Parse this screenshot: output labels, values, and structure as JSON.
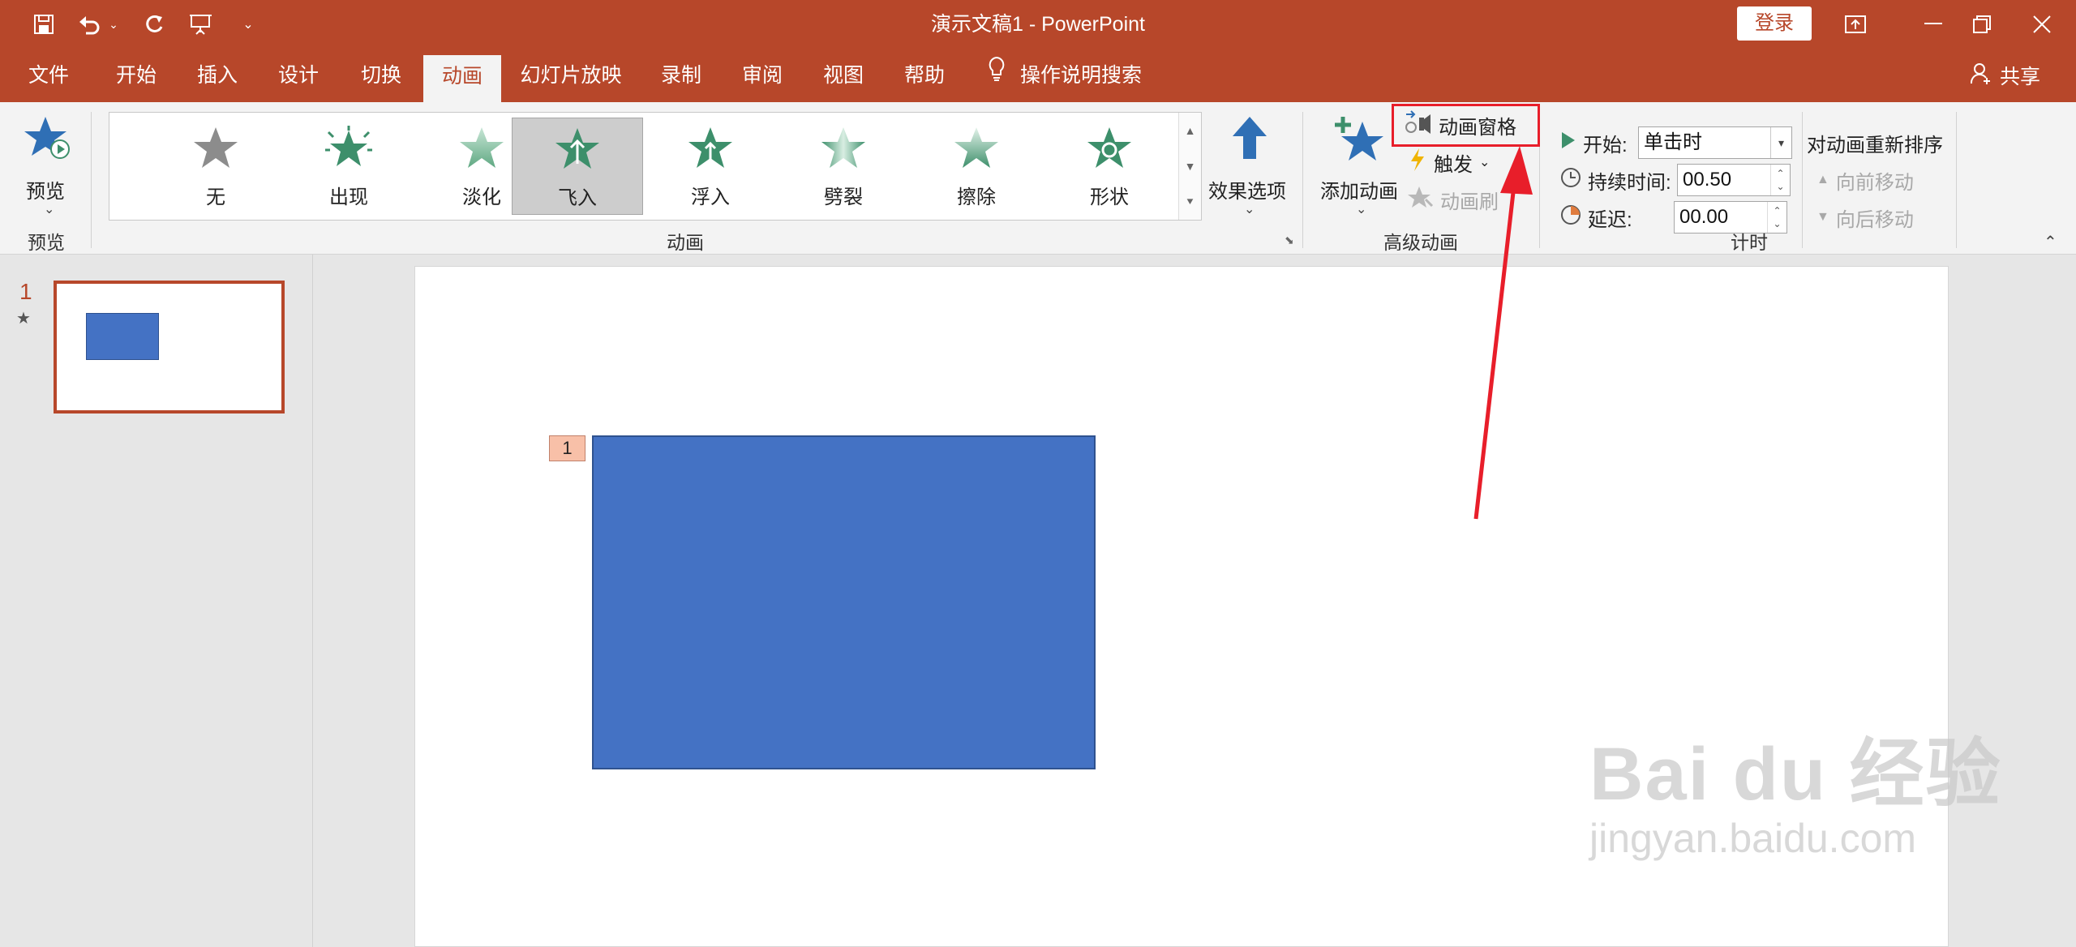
{
  "titlebar": {
    "document_title": "演示文稿1  -  PowerPoint",
    "login_label": "登录"
  },
  "tabs": [
    {
      "label": "文件"
    },
    {
      "label": "开始"
    },
    {
      "label": "插入"
    },
    {
      "label": "设计"
    },
    {
      "label": "切换"
    },
    {
      "label": "动画"
    },
    {
      "label": "幻灯片放映"
    },
    {
      "label": "录制"
    },
    {
      "label": "审阅"
    },
    {
      "label": "视图"
    },
    {
      "label": "帮助"
    }
  ],
  "active_tab": "动画",
  "search_label": "操作说明搜索",
  "share_label": "共享",
  "ribbon": {
    "preview": {
      "button_label": "预览",
      "group_label": "预览"
    },
    "animation": {
      "group_label": "动画",
      "effects": [
        {
          "label": "无",
          "color": "#8c8c8c"
        },
        {
          "label": "出现",
          "color": "#3d8f6b"
        },
        {
          "label": "淡化",
          "color": "#8cc4a8"
        },
        {
          "label": "飞入",
          "color": "#3d8f6b"
        },
        {
          "label": "浮入",
          "color": "#3d8f6b"
        },
        {
          "label": "劈裂",
          "color": "#3d8f6b"
        },
        {
          "label": "擦除",
          "color": "#6fb08e"
        },
        {
          "label": "形状",
          "color": "#3d8f6b"
        }
      ],
      "selected_effect": "飞入",
      "effect_options_label": "效果选项"
    },
    "advanced": {
      "group_label": "高级动画",
      "add_animation_label": "添加动画",
      "animation_pane_label": "动画窗格",
      "trigger_label": "触发",
      "painter_label": "动画刷"
    },
    "timing": {
      "group_label": "计时",
      "start_label": "开始:",
      "start_value": "单击时",
      "duration_label": "持续时间:",
      "duration_value": "00.50",
      "delay_label": "延迟:",
      "delay_value": "00.00",
      "reorder_label": "对动画重新排序",
      "move_earlier_label": "向前移动",
      "move_later_label": "向后移动"
    }
  },
  "slides": [
    {
      "number": "1"
    }
  ],
  "slide": {
    "animation_tag": "1",
    "shape_color": "#4472c4"
  },
  "watermark": {
    "main": "Bai du 经验",
    "sub": "jingyan.baidu.com"
  },
  "colors": {
    "accent": "#b7472a",
    "highlight": "#e81e2a"
  }
}
